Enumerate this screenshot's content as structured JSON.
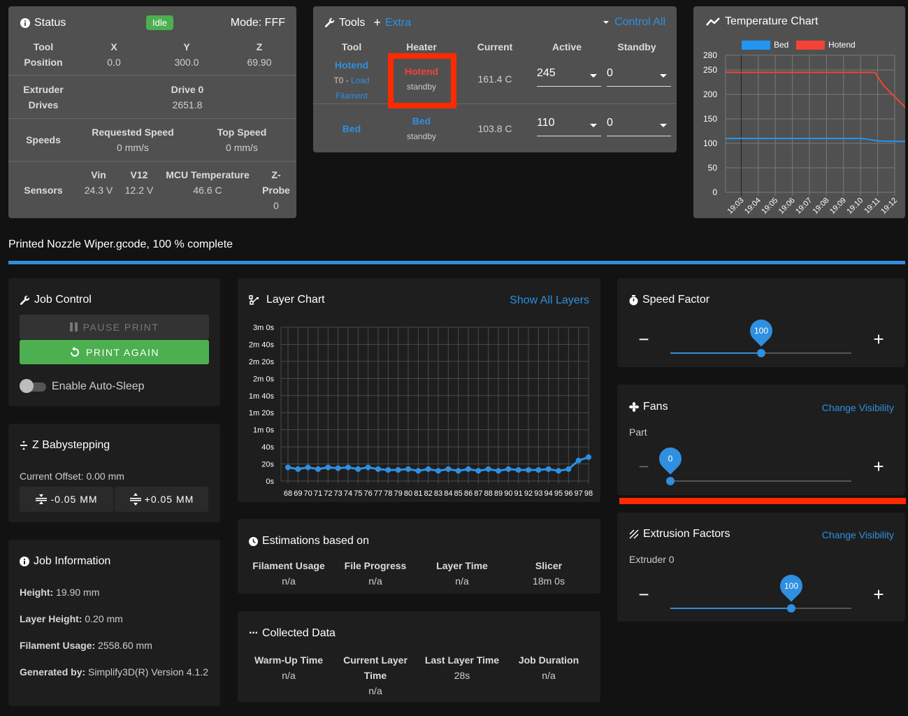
{
  "status": {
    "title": "Status",
    "state": "Idle",
    "mode": "Mode: FFF",
    "tool_position": {
      "label_1": "Tool",
      "label_2": "Position",
      "axes": [
        {
          "axis": "X",
          "value": "0.0"
        },
        {
          "axis": "Y",
          "value": "300.0"
        },
        {
          "axis": "Z",
          "value": "69.90"
        }
      ]
    },
    "extruder": {
      "label_1": "Extruder",
      "label_2": "Drives",
      "drive_label": "Drive 0",
      "drive_value": "2651.8"
    },
    "speeds": {
      "label": "Speeds",
      "requested_label": "Requested Speed",
      "requested_value": "0 mm/s",
      "top_label": "Top Speed",
      "top_value": "0 mm/s"
    },
    "sensors": {
      "label": "Sensors",
      "vin_label": "Vin",
      "vin_value": "24.3 V",
      "v12_label": "V12",
      "v12_value": "12.2 V",
      "mcu_label": "MCU Temperature",
      "mcu_value": "46.6 C",
      "zprobe_label_1": "Z-",
      "zprobe_label_2": "Probe",
      "zprobe_value": "0"
    }
  },
  "tools": {
    "title": "Tools",
    "extra": "Extra",
    "control_all": "Control All",
    "headers": [
      "Tool",
      "Heater",
      "Current",
      "Active",
      "Standby"
    ],
    "rows": [
      {
        "tool": "Hotend",
        "tool_sub_prefix": "T0 - ",
        "tool_sub_link": "Load",
        "tool_sub_link2": "Filament",
        "heater": "Hotend",
        "heater_state": "standby",
        "current": "161.4 C",
        "active": "245",
        "standby": "0"
      },
      {
        "tool": "Bed",
        "heater": "Bed",
        "heater_state": "standby",
        "current": "103.8 C",
        "active": "110",
        "standby": "0"
      }
    ]
  },
  "colors": {
    "accent": "#2f8fe0",
    "bed": "#2196f3",
    "hotend": "#f44336",
    "success": "#4caf50",
    "highlight": "#ff2a00"
  },
  "chart_data": [
    {
      "type": "line",
      "title": "Temperature Chart",
      "legend": [
        "Bed",
        "Hotend"
      ],
      "legend_position": "top",
      "x": [
        "19:03",
        "19:04",
        "19:05",
        "19:06",
        "19:07",
        "19:08",
        "19:09",
        "19:10",
        "19:11",
        "19:12"
      ],
      "ylim": [
        0,
        280
      ],
      "yticks": [
        0,
        50,
        100,
        150,
        200,
        250,
        280
      ],
      "grid": true,
      "series": [
        {
          "name": "Bed",
          "color": "#2196f3",
          "points": [
            [
              0,
              110
            ],
            [
              1,
              110
            ],
            [
              2,
              110
            ],
            [
              3,
              110
            ],
            [
              4,
              110
            ],
            [
              5,
              110
            ],
            [
              6,
              110
            ],
            [
              7,
              110
            ],
            [
              7.3,
              109
            ],
            [
              8,
              105
            ],
            [
              9,
              104
            ],
            [
              9.9,
              103.8
            ]
          ]
        },
        {
          "name": "Hotend",
          "color": "#f44336",
          "points": [
            [
              0,
              245
            ],
            [
              1,
              245
            ],
            [
              2,
              245
            ],
            [
              3,
              245
            ],
            [
              4,
              245
            ],
            [
              5,
              245
            ],
            [
              6,
              245
            ],
            [
              7,
              245
            ],
            [
              7.85,
              245
            ],
            [
              8.3,
              220
            ],
            [
              9,
              195
            ],
            [
              9.5,
              178
            ],
            [
              9.9,
              161.4
            ]
          ]
        }
      ]
    },
    {
      "type": "line",
      "title": "Layer Chart",
      "xlabel": "",
      "ylabel": "",
      "x": [
        68,
        69,
        70,
        71,
        72,
        73,
        74,
        75,
        76,
        77,
        78,
        79,
        80,
        81,
        82,
        83,
        84,
        85,
        86,
        87,
        88,
        89,
        90,
        91,
        92,
        93,
        94,
        95,
        96,
        97,
        98
      ],
      "values": [
        16,
        14,
        16,
        14,
        16,
        15,
        16,
        14,
        16,
        14,
        13,
        13,
        14,
        12,
        14,
        12,
        14,
        12,
        14,
        12,
        14,
        12,
        14,
        13,
        13,
        13,
        14,
        12,
        14,
        24,
        28
      ],
      "ylim": [
        0,
        180
      ],
      "yticks": [
        "0s",
        "20s",
        "40s",
        "1m 0s",
        "1m 20s",
        "1m 40s",
        "2m 0s",
        "2m 20s",
        "2m 40s",
        "3m 0s"
      ],
      "grid": true,
      "series_color": "#2f8fe0"
    }
  ],
  "progress": {
    "text": "Printed Nozzle Wiper.gcode, 100 % complete",
    "fraction": 1.0
  },
  "job_control": {
    "title": "Job Control",
    "pause_label": "PAUSE PRINT",
    "again_label": "PRINT AGAIN",
    "auto_sleep_label": "Enable Auto-Sleep",
    "auto_sleep_enabled": false
  },
  "babystepping": {
    "title": "Z Babystepping",
    "offset": "Current Offset: 0.00 mm",
    "minus_label": "-0.05 MM",
    "plus_label": "+0.05 MM"
  },
  "job_info": {
    "title": "Job Information",
    "items": [
      {
        "label": "Height:",
        "value": " 19.90 mm"
      },
      {
        "label": "Layer Height:",
        "value": " 0.20 mm"
      },
      {
        "label": "Filament Usage:",
        "value": " 2558.60 mm"
      },
      {
        "label": "Generated by:",
        "value": " Simplify3D(R) Version 4.1.2"
      }
    ]
  },
  "layer_chart": {
    "title": "Layer Chart",
    "show_all": "Show All Layers"
  },
  "estimations": {
    "title": "Estimations based on",
    "cols": [
      {
        "label": "Filament Usage",
        "value": "n/a"
      },
      {
        "label": "File Progress",
        "value": "n/a"
      },
      {
        "label": "Layer Time",
        "value": "n/a"
      },
      {
        "label": "Slicer",
        "value": "18m 0s"
      }
    ]
  },
  "collected": {
    "title": "Collected Data",
    "cols": [
      {
        "label": "Warm-Up Time",
        "value": "n/a"
      },
      {
        "label": "Current Layer Time",
        "value": "n/a"
      },
      {
        "label": "Last Layer Time",
        "value": "28s"
      },
      {
        "label": "Job Duration",
        "value": "n/a"
      }
    ]
  },
  "speed_factor": {
    "title": "Speed Factor",
    "value": "100",
    "fraction": 0.5,
    "minus": "−",
    "plus": "+"
  },
  "fans": {
    "title": "Fans",
    "change_visibility": "Change Visibility",
    "part_label": "Part",
    "value": "0",
    "fraction": 0.0,
    "minus": "−",
    "plus": "+"
  },
  "extrusion": {
    "title": "Extrusion Factors",
    "change_visibility": "Change Visibility",
    "extruder_label": "Extruder 0",
    "value": "100",
    "fraction": 0.667,
    "minus": "−",
    "plus": "+"
  }
}
